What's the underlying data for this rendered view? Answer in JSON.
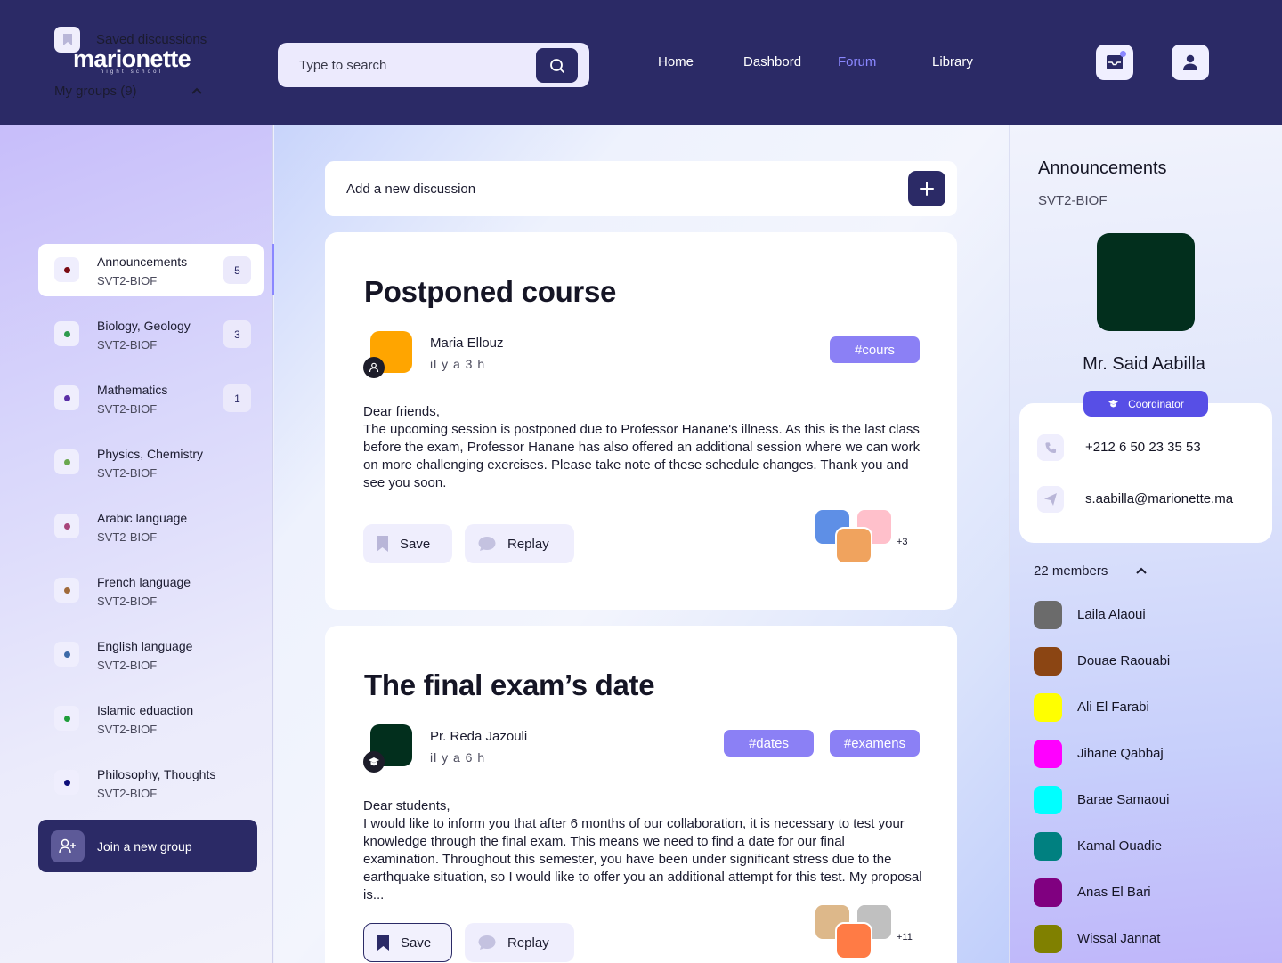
{
  "header": {
    "logo": {
      "main": "marionette",
      "sub": "night school"
    },
    "search_placeholder": "Type to search",
    "nav": [
      {
        "label": "Home",
        "active": false
      },
      {
        "label": "Dashbord",
        "active": false
      },
      {
        "label": "Forum",
        "active": true
      },
      {
        "label": "Library",
        "active": false
      }
    ],
    "icons": {
      "search": "search-icon",
      "inbox": "inbox-icon",
      "profile": "user-icon"
    }
  },
  "sidebar": {
    "saved_label": "Saved discussions",
    "groups_header": "My groups (9)",
    "groups": [
      {
        "name": "Announcements",
        "sub": "SVT2-BIOF",
        "badge": "5",
        "dot": "#7a0a12",
        "active": true
      },
      {
        "name": "Biology, Geology",
        "sub": "SVT2-BIOF",
        "badge": "3",
        "dot": "#2e9b4e",
        "active": false
      },
      {
        "name": "Mathematics",
        "sub": "SVT2-BIOF",
        "badge": "1",
        "dot": "#5a2ea6",
        "active": false
      },
      {
        "name": "Physics, Chemistry",
        "sub": "SVT2-BIOF",
        "badge": "",
        "dot": "#6aa84f",
        "active": false
      },
      {
        "name": "Arabic language",
        "sub": "SVT2-BIOF",
        "badge": "",
        "dot": "#a8457a",
        "active": false
      },
      {
        "name": "French language",
        "sub": "SVT2-BIOF",
        "badge": "",
        "dot": "#a06a3a",
        "active": false
      },
      {
        "name": "English language",
        "sub": "SVT2-BIOF",
        "badge": "",
        "dot": "#3d6aa8",
        "active": false
      },
      {
        "name": "Islamic eduaction",
        "sub": "SVT2-BIOF",
        "badge": "",
        "dot": "#1f9d3a",
        "active": false
      },
      {
        "name": "Philosophy, Thoughts",
        "sub": "SVT2-BIOF",
        "badge": "",
        "dot": "#0d0d7a",
        "active": false
      }
    ],
    "join_label": "Join a new group"
  },
  "main": {
    "new_discussion_label": "Add a new discussion",
    "posts": [
      {
        "title": "Postponed course",
        "author": "Maria Ellouz",
        "time": "il y a 3 h",
        "avatar_color": "#ffa500",
        "role_icon": "user-icon",
        "tags": [
          "#cours"
        ],
        "body": "Dear friends,\nThe upcoming session is postponed due to Professor Hanane's illness. As this is the last class before the exam, Professor Hanane has also offered an additional session where we can work on more challenging exercises. Please take note of these schedule changes. Thank you and see you soon.",
        "save_label": "Save",
        "reply_label": "Replay",
        "stack_colors": [
          "#5e8fe6",
          "#ffc0cb",
          "#f0a35e"
        ],
        "stack_more": "+3"
      },
      {
        "title": "The final exam’s date",
        "author": "Pr. Reda Jazouli",
        "time": "il y a 6 h",
        "avatar_color": "#022f1d",
        "role_icon": "graduation-cap-icon",
        "tags": [
          "#dates",
          "#examens"
        ],
        "body": "Dear students,\nI would like to inform you that after 6 months of our collaboration, it is necessary to test your knowledge through the final exam. This means we need to find a date for our final examination. Throughout this semester, you have been under significant stress due to the earthquake situation, so I would like to offer you an additional attempt for this test. My proposal is...",
        "save_label": "Save",
        "reply_label": "Replay",
        "stack_colors": [
          "#ddb88a",
          "#c0c0c0",
          "#ff7b45"
        ],
        "stack_more": "+11"
      }
    ]
  },
  "right": {
    "title": "Announcements",
    "sub": "SVT2-BIOF",
    "coordinator_name": "Mr. Said Aabilla",
    "role_label": "Coordinator",
    "phone": "+212 6 50 23 35 53",
    "email": "s.aabilla@marionette.ma",
    "members_header": "22 members",
    "members": [
      {
        "name": "Laila Alaoui",
        "color": "#6b6b6b"
      },
      {
        "name": "Douae Raouabi",
        "color": "#8b4513"
      },
      {
        "name": "Ali El Farabi",
        "color": "#ffff00"
      },
      {
        "name": "Jihane Qabbaj",
        "color": "#ff00ff"
      },
      {
        "name": "Barae Samaoui",
        "color": "#00ffff"
      },
      {
        "name": "Kamal Ouadie",
        "color": "#008080"
      },
      {
        "name": "Anas El Bari",
        "color": "#800080"
      },
      {
        "name": "Wissal Jannat",
        "color": "#808000"
      }
    ]
  }
}
